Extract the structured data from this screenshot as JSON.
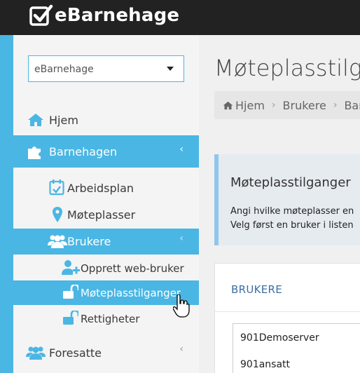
{
  "app": {
    "logo_text": "eBarnehage"
  },
  "select": {
    "value": "eBarnehage"
  },
  "nav": {
    "hjem": "Hjem",
    "barnehagen": "Barnehagen",
    "arbeidsplan": "Arbeidsplan",
    "moteplasser": "Møteplasser",
    "brukere": "Brukere",
    "opprett": "Opprett web-bruker",
    "moteplasstilganger": "Møteplasstilganger",
    "rettigheter": "Rettigheter",
    "foresatte": "Foresatte"
  },
  "main": {
    "title": "Møteplasstilganger",
    "breadcrumb": [
      "Hjem",
      "Brukere",
      "Barnehage"
    ],
    "info": {
      "title": "Møteplasstilganger",
      "line1": "Angi hvilke møteplasser en",
      "line2": "Velg først en bruker i listen"
    },
    "panel": {
      "title": "BRUKERE",
      "users": [
        "901Demoserver",
        "901ansatt"
      ]
    }
  },
  "colors": {
    "accent": "#4ab6e4",
    "topbar": "#222222",
    "panel_title": "#3b6fa3"
  },
  "icons": [
    "check-logo-icon",
    "home-icon",
    "puzzle-icon",
    "calendar-icon",
    "map-marker-icon",
    "users-icon",
    "user-plus-icon",
    "unlock-icon",
    "hand-cursor-icon"
  ]
}
